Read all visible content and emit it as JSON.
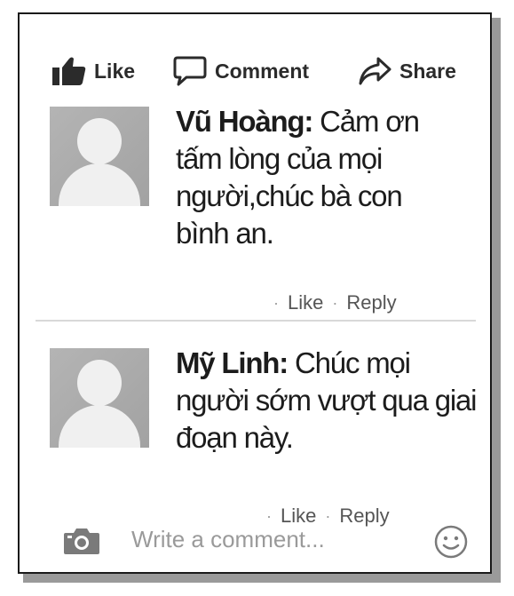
{
  "actions": {
    "like_label": "Like",
    "comment_label": "Comment",
    "share_label": "Share",
    "icons": [
      "thumbs-up-icon",
      "speech-bubble-icon",
      "share-arrow-icon"
    ]
  },
  "comments": [
    {
      "author": "Vũ Hoàng:",
      "text": " Cảm ơn tấm lòng của mọi người,chúc bà con bình an.",
      "like_label": "Like",
      "reply_label": "Reply"
    },
    {
      "author": "Mỹ Linh:",
      "text": " Chúc mọi người sớm vượt qua giai đoạn này.",
      "like_label": "Like",
      "reply_label": "Reply"
    }
  ],
  "composer": {
    "placeholder": "Write a comment..."
  },
  "colors": {
    "text": "#1c1c1c",
    "muted": "#555555",
    "avatar_bg": "#a8a8a8",
    "border": "#1a1a1a"
  }
}
